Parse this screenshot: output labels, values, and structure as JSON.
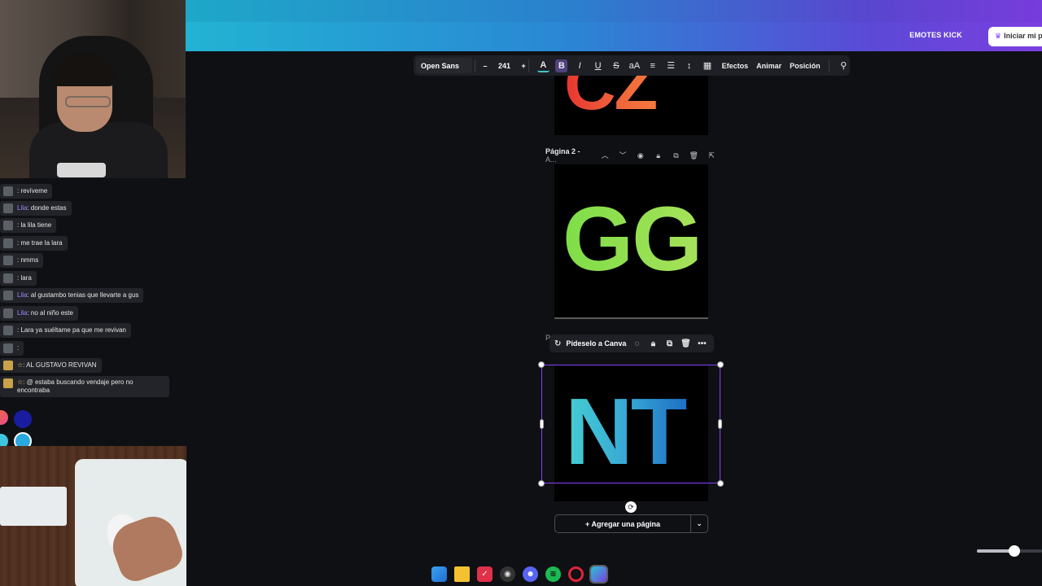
{
  "header": {
    "emotes_label": "EMOTES KICK",
    "start_label": "Iniciar mi p"
  },
  "toolbar": {
    "font": "Open Sans",
    "minus": "–",
    "size": "241",
    "plus": "+",
    "bold": "B",
    "italic": "I",
    "underline": "U",
    "strike": "S",
    "case": "aA",
    "effects": "Efectos",
    "animate": "Animar",
    "position": "Posición"
  },
  "pages": {
    "page1_text": "CZ",
    "page2_label": "Página 2 -",
    "page2_sub": " A...",
    "page2_text": "GG",
    "page3_label": "Pá",
    "page3_text": "NT"
  },
  "float_bar": {
    "ask_label": "Pídeselo a Canva"
  },
  "add_page": {
    "label": "+ Agregar una página"
  },
  "chat": [
    {
      "user": "",
      "text": ": revíveme"
    },
    {
      "user": "Lila",
      "text": ": donde estas"
    },
    {
      "user": "",
      "text": ": la lila tiene"
    },
    {
      "user": "",
      "text": ": me trae la lara"
    },
    {
      "user": "",
      "text": ": nmms"
    },
    {
      "user": "",
      "text": ": lara"
    },
    {
      "user": "Lila",
      "text": ": al gustambo tenias que llevarte a gus"
    },
    {
      "user": "Lila",
      "text": ": no al niño este"
    },
    {
      "user": "",
      "text": ": Lara ya suéltame pa que me revivan"
    },
    {
      "user": "",
      "text": ":"
    },
    {
      "user": "☆",
      "text": ": AL GUSTAVO REVIVAN"
    },
    {
      "user": "☆",
      "text": ": @ estaba buscando vendaje pero no encontraba"
    }
  ],
  "colors": {
    "accent": "#8b3dff",
    "header_start": "#22b3d3",
    "header_end": "#7b3fe0"
  }
}
